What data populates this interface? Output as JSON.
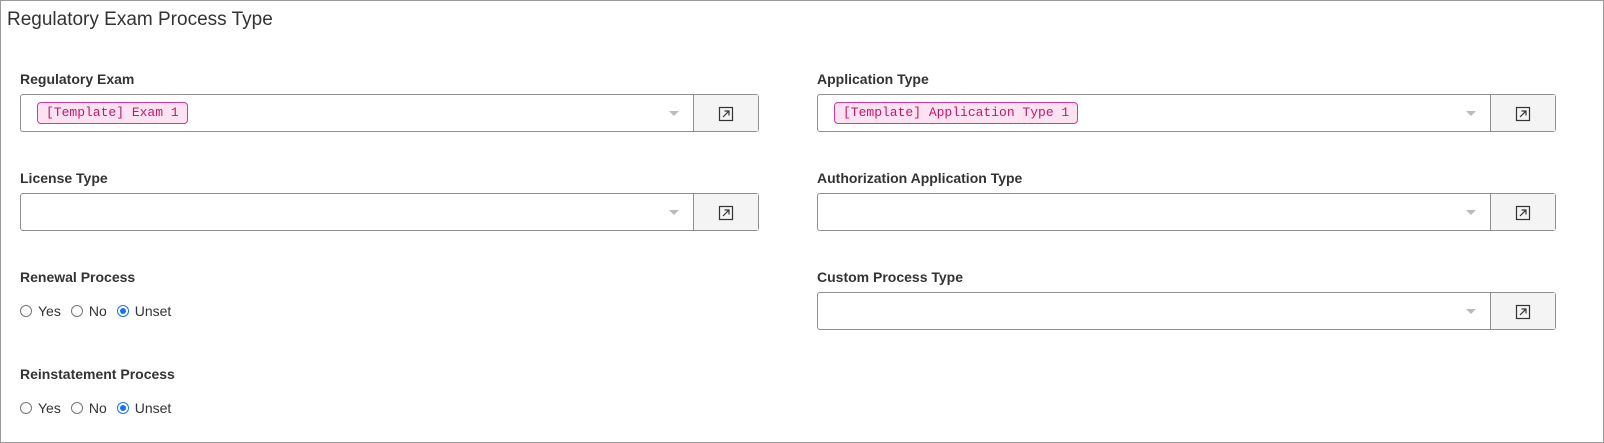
{
  "page": {
    "title": "Regulatory Exam Process Type"
  },
  "fields": {
    "regulatory_exam": {
      "label": "Regulatory Exam",
      "value": "[Template] Exam 1"
    },
    "application_type": {
      "label": "Application Type",
      "value": "[Template] Application Type 1"
    },
    "license_type": {
      "label": "License Type",
      "value": ""
    },
    "authorization_application_type": {
      "label": "Authorization Application Type",
      "value": ""
    },
    "custom_process_type": {
      "label": "Custom Process Type",
      "value": ""
    }
  },
  "renewal_process": {
    "label": "Renewal Process",
    "options": [
      "Yes",
      "No",
      "Unset"
    ],
    "selected": "Unset"
  },
  "reinstatement_process": {
    "label": "Reinstatement Process",
    "options": [
      "Yes",
      "No",
      "Unset"
    ],
    "selected": "Unset"
  },
  "icons": {
    "dropdown": "chevron-down-icon",
    "open_record": "external-link-icon"
  },
  "colors": {
    "chip_border": "#d6379a",
    "chip_background": "#fde3f1",
    "chip_text": "#c2186f",
    "radio_selected": "#1a73e8"
  }
}
